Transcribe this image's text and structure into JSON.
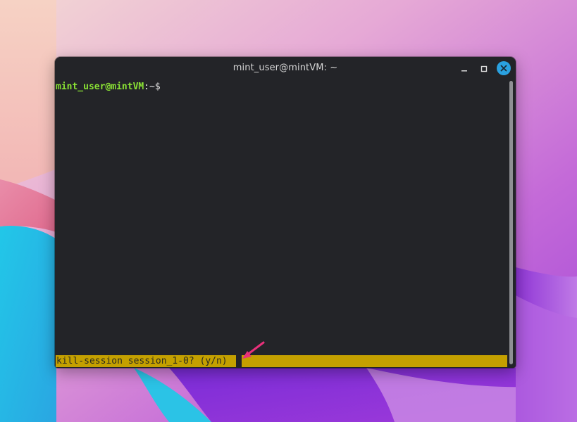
{
  "window": {
    "title": "mint_user@mintVM: ~"
  },
  "terminal": {
    "prompt_user": "mint_user@mintVM",
    "prompt_path": ":~$",
    "status_message": "kill-session session_1-0? (y/n)"
  },
  "icons": {
    "minimize": "minimize-icon",
    "maximize": "maximize-icon",
    "close": "close-icon",
    "annotation": "arrow-icon"
  },
  "colors": {
    "terminal_bg": "#232428",
    "prompt_user": "#8ae234",
    "status_bar": "#c4a000",
    "close_button": "#2aa1e0",
    "annotation_arrow": "#e8307a"
  }
}
